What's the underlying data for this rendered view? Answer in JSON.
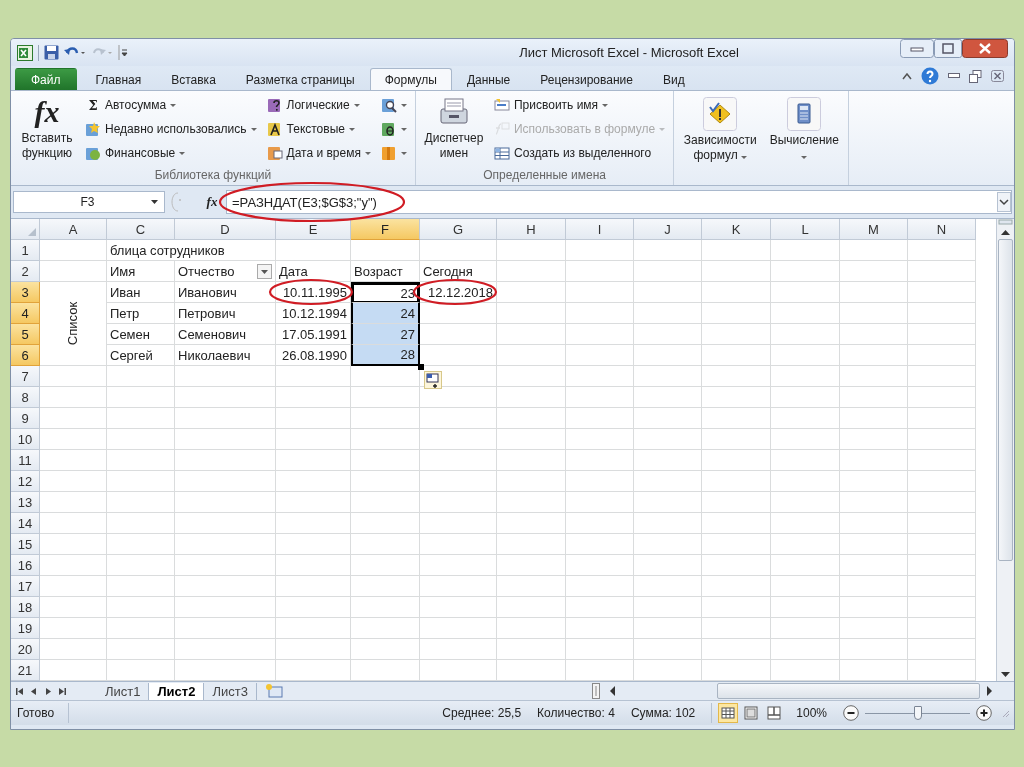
{
  "window": {
    "title": "Лист Microsoft Excel - Microsoft Excel"
  },
  "ribbon_tabs": [
    {
      "label": "Файл",
      "kind": "file",
      "selected": false
    },
    {
      "label": "Главная",
      "kind": "tab",
      "selected": false
    },
    {
      "label": "Вставка",
      "kind": "tab",
      "selected": false
    },
    {
      "label": "Разметка страницы",
      "kind": "tab",
      "selected": false
    },
    {
      "label": "Формулы",
      "kind": "tab",
      "selected": true
    },
    {
      "label": "Данные",
      "kind": "tab",
      "selected": false
    },
    {
      "label": "Рецензирование",
      "kind": "tab",
      "selected": false
    },
    {
      "label": "Вид",
      "kind": "tab",
      "selected": false
    }
  ],
  "ribbon_groups": [
    {
      "label": "Библиотека функций",
      "large_buttons": [
        {
          "label": "Вставить функцию",
          "kind": "insert-function",
          "glyph": "fx",
          "dropdown": false
        }
      ],
      "columns": [
        [
          {
            "label": "Автосумма",
            "kind": "sigma",
            "glyph": "Σ",
            "dropdown": true,
            "disabled": false
          },
          {
            "label": "Недавно использовались",
            "kind": "recent",
            "dropdown": true,
            "disabled": false
          },
          {
            "label": "Финансовые",
            "kind": "finance",
            "dropdown": true,
            "disabled": false
          }
        ],
        [
          {
            "label": "Логические",
            "kind": "logical",
            "dropdown": true,
            "disabled": false
          },
          {
            "label": "Текстовые",
            "kind": "text",
            "dropdown": true,
            "disabled": false
          },
          {
            "label": "Дата и время",
            "kind": "datetime",
            "dropdown": true,
            "disabled": false
          }
        ],
        [
          {
            "kind": "lookup",
            "dropdown": true,
            "disabled": false
          },
          {
            "kind": "math",
            "dropdown": true,
            "disabled": false
          },
          {
            "kind": "more",
            "dropdown": true,
            "disabled": false
          }
        ]
      ]
    },
    {
      "label": "Определенные имена",
      "large_buttons": [
        {
          "label": "Диспетчер имен",
          "kind": "name-manager",
          "dropdown": false
        }
      ],
      "columns": [
        [
          {
            "label": "Присвоить имя",
            "kind": "define-name",
            "dropdown": true,
            "disabled": false
          },
          {
            "label": "Использовать в формуле",
            "kind": "use-in-formula",
            "dropdown": true,
            "disabled": true
          },
          {
            "label": "Создать из выделенного",
            "kind": "create-from-selection",
            "dropdown": false,
            "disabled": false
          }
        ]
      ]
    },
    {
      "large_buttons": [
        {
          "label": "Зависимости формул",
          "kind": "auditing",
          "dropdown": true
        },
        {
          "label": "Вычисление",
          "kind": "calculation",
          "dropdown": true
        }
      ]
    }
  ],
  "formula_bar": {
    "name_box": "F3",
    "fx_glyph": "fx",
    "formula": "=РАЗНДАТ(E3;$G$3;\"y\")",
    "circled": true
  },
  "sheet": {
    "columns": [
      {
        "letter": "A",
        "selected": false
      },
      {
        "letter": "C",
        "selected": false
      },
      {
        "letter": "D",
        "selected": false
      },
      {
        "letter": "E",
        "selected": false
      },
      {
        "letter": "F",
        "selected": true
      },
      {
        "letter": "G",
        "selected": false
      },
      {
        "letter": "H",
        "selected": false
      },
      {
        "letter": "I",
        "selected": false
      },
      {
        "letter": "J",
        "selected": false
      },
      {
        "letter": "K",
        "selected": false
      },
      {
        "letter": "L",
        "selected": false
      },
      {
        "letter": "M",
        "selected": false
      },
      {
        "letter": "N",
        "selected": false
      }
    ],
    "rows": [
      {
        "number": "1",
        "selected": false,
        "cells": {
          "C": {
            "text": "блица сотрудников",
            "kind": "text",
            "selected": false,
            "active": false
          }
        }
      },
      {
        "number": "2",
        "selected": false,
        "cells": {
          "C": {
            "text": "Имя",
            "kind": "text",
            "selected": false,
            "active": false
          },
          "D": {
            "text": "Отчество",
            "kind": "text",
            "filter": true,
            "selected": false,
            "active": false
          },
          "E": {
            "text": "Дата",
            "kind": "text",
            "selected": false,
            "active": false
          },
          "F": {
            "text": "Возраст",
            "kind": "text",
            "selected": false,
            "active": false
          },
          "G": {
            "text": "Сегодня",
            "kind": "text",
            "selected": false,
            "active": false
          }
        }
      },
      {
        "number": "3",
        "selected": true,
        "cells": {
          "A": {
            "text": "Список",
            "kind": "vertical",
            "selected": false,
            "active": false
          },
          "C": {
            "text": "Иван",
            "kind": "text",
            "selected": false,
            "active": false
          },
          "D": {
            "text": "Иванович",
            "kind": "text",
            "selected": false,
            "active": false
          },
          "E": {
            "text": "10.11.1995",
            "kind": "number",
            "circled": true,
            "selected": false,
            "active": false
          },
          "F": {
            "text": "23",
            "kind": "number",
            "selected": true,
            "active": true
          },
          "G": {
            "text": "12.12.2018",
            "kind": "number",
            "circled": true,
            "selected": false,
            "active": false
          }
        }
      },
      {
        "number": "4",
        "selected": true,
        "cells": {
          "C": {
            "text": "Петр",
            "kind": "text",
            "selected": false,
            "active": false
          },
          "D": {
            "text": "Петрович",
            "kind": "text",
            "selected": false,
            "active": false
          },
          "E": {
            "text": "10.12.1994",
            "kind": "number",
            "selected": false,
            "active": false
          },
          "F": {
            "text": "24",
            "kind": "number",
            "selected": true,
            "active": false
          }
        }
      },
      {
        "number": "5",
        "selected": true,
        "cells": {
          "C": {
            "text": "Семен",
            "kind": "text",
            "selected": false,
            "active": false
          },
          "D": {
            "text": "Семенович",
            "kind": "text",
            "selected": false,
            "active": false
          },
          "E": {
            "text": "17.05.1991",
            "kind": "number",
            "selected": false,
            "active": false
          },
          "F": {
            "text": "27",
            "kind": "number",
            "selected": true,
            "active": false
          }
        }
      },
      {
        "number": "6",
        "selected": true,
        "cells": {
          "C": {
            "text": "Сергей",
            "kind": "text",
            "selected": false,
            "active": false
          },
          "D": {
            "text": "Николаевич",
            "kind": "text",
            "selected": false,
            "active": false
          },
          "E": {
            "text": "26.08.1990",
            "kind": "number",
            "selected": false,
            "active": false
          },
          "F": {
            "text": "28",
            "kind": "number",
            "selected": true,
            "active": false
          }
        }
      },
      {
        "number": "7",
        "selected": false
      },
      {
        "number": "8",
        "selected": false
      },
      {
        "number": "9",
        "selected": false
      },
      {
        "number": "10",
        "selected": false
      },
      {
        "number": "11",
        "selected": false
      },
      {
        "number": "12",
        "selected": false
      },
      {
        "number": "13",
        "selected": false
      },
      {
        "number": "14",
        "selected": false
      },
      {
        "number": "15",
        "selected": false
      },
      {
        "number": "16",
        "selected": false
      },
      {
        "number": "17",
        "selected": false
      },
      {
        "number": "18",
        "selected": false
      },
      {
        "number": "19",
        "selected": false
      },
      {
        "number": "20",
        "selected": false
      },
      {
        "number": "21",
        "selected": false
      }
    ]
  },
  "sheet_tabs": [
    {
      "label": "Лист1",
      "selected": false
    },
    {
      "label": "Лист2",
      "selected": true
    },
    {
      "label": "Лист3",
      "selected": false
    }
  ],
  "status_bar": {
    "ready": "Готово",
    "average": "Среднее: 25,5",
    "count": "Количество: 4",
    "sum": "Сумма: 102",
    "views": [
      {
        "kind": "normal",
        "selected": true
      },
      {
        "kind": "page-layout",
        "selected": false
      },
      {
        "kind": "page-break",
        "selected": false
      }
    ],
    "zoom": "100%",
    "zoom_slider": {
      "level": 0.5
    }
  }
}
